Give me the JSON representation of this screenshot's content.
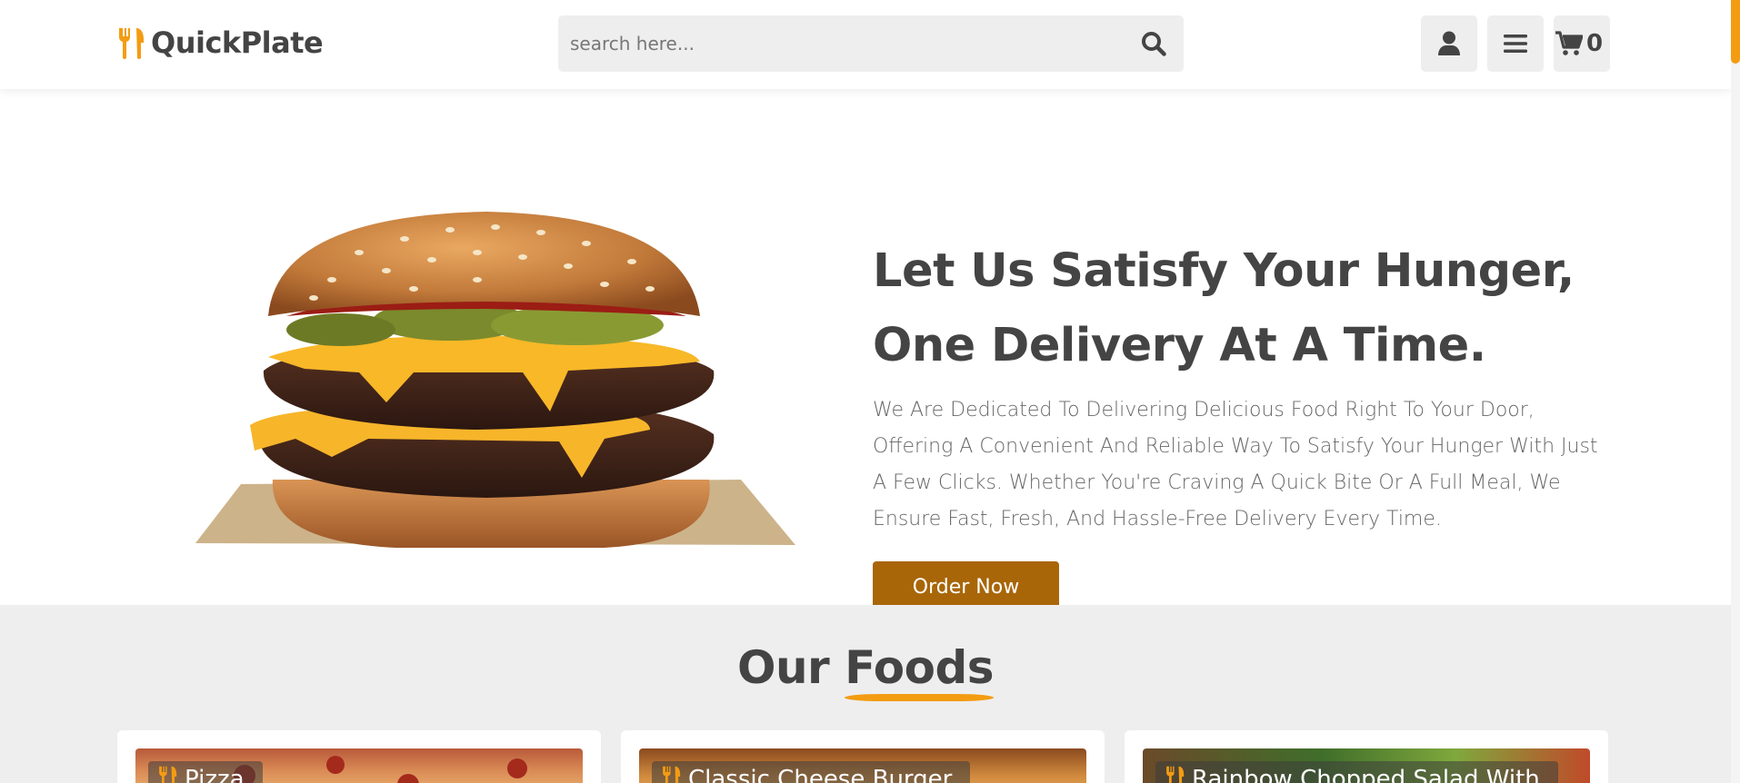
{
  "header": {
    "brand": "QuickPlate",
    "search_placeholder": "search here...",
    "cart_count": "0"
  },
  "hero": {
    "title_line1": "Let Us Satisfy Your Hunger,",
    "title_line2": "One Delivery At A Time.",
    "description": "We Are Dedicated To Delivering Delicious Food Right To Your Door, Offering A Convenient And Reliable Way To Satisfy Your Hunger With Just A Few Clicks. Whether You're Craving A Quick Bite Or A Full Meal, We Ensure Fast, Fresh, And Hassle-Free Delivery Every Time.",
    "cta_label": "Order Now"
  },
  "foods": {
    "title_plain": "Our",
    "title_accent": "Foods",
    "cards": [
      {
        "label": "Pizza"
      },
      {
        "label": "Classic Cheese Burger"
      },
      {
        "label": "Rainbow Chopped Salad With"
      }
    ]
  },
  "colors": {
    "accent": "#f39c12",
    "button": "#a86608",
    "text": "#444444",
    "section_bg": "#eeeeee"
  },
  "icons": [
    "utensils-icon",
    "search-icon",
    "user-icon",
    "bars-icon",
    "cart-icon"
  ]
}
